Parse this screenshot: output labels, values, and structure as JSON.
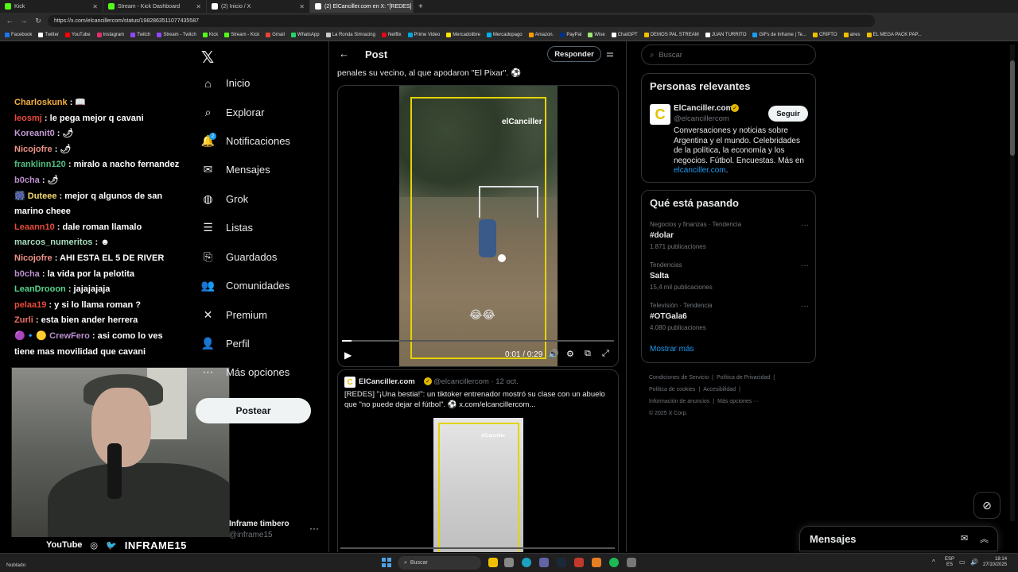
{
  "browser": {
    "tabs": [
      {
        "label": "Kick",
        "color": "#53fc18"
      },
      {
        "label": "Stream - Kick Dashboard",
        "color": "#53fc18"
      },
      {
        "label": "(2) Inicio / X",
        "color": "#ffffff"
      },
      {
        "label": "(2) ElCanciller.com en X: \"[REDES]",
        "color": "#ffffff"
      }
    ],
    "url": "https://x.com/elcancillercom/status/1982863511077435587",
    "bookmarks": [
      {
        "label": "Facebook",
        "color": "#1877f2"
      },
      {
        "label": "Twitter",
        "color": "#ffffff"
      },
      {
        "label": "YouTube",
        "color": "#ff0000"
      },
      {
        "label": "Instagram",
        "color": "#e1306c"
      },
      {
        "label": "Twitch",
        "color": "#9146ff"
      },
      {
        "label": "Stream - Twitch",
        "color": "#9146ff"
      },
      {
        "label": "Kick",
        "color": "#53fc18"
      },
      {
        "label": "Stream - Kick",
        "color": "#53fc18"
      },
      {
        "label": "Gmail",
        "color": "#ea4335"
      },
      {
        "label": "WhatsApp",
        "color": "#25d366"
      },
      {
        "label": "La Ronda Simracing",
        "color": "#cccccc"
      },
      {
        "label": "Netflix",
        "color": "#e50914"
      },
      {
        "label": "Prime Video",
        "color": "#00a8e1"
      },
      {
        "label": "Mercadolibre",
        "color": "#ffe600"
      },
      {
        "label": "Mercadopago",
        "color": "#00b1ea"
      },
      {
        "label": "Amazon.",
        "color": "#ff9900"
      },
      {
        "label": "PayPal",
        "color": "#003087"
      },
      {
        "label": "Wise",
        "color": "#9fe870"
      },
      {
        "label": "ChatGPT",
        "color": "#ffffff"
      },
      {
        "label": "DEMOS PAL STREAM",
        "color": "#f0c000"
      },
      {
        "label": "JUAN TURRITO",
        "color": "#ffffff"
      },
      {
        "label": "GIFs de Inframe | Te...",
        "color": "#1d9bf0"
      },
      {
        "label": "CRIPTO",
        "color": "#f0c000"
      },
      {
        "label": "aires",
        "color": "#f0c000"
      },
      {
        "label": "EL MEGA PACK PAP...",
        "color": "#f0c000"
      }
    ]
  },
  "chat": [
    {
      "user": "Charloskunk",
      "color": "#f5b041",
      "text": " : 📖"
    },
    {
      "user": "leosmj",
      "color": "#e74c3c",
      "text": " : le pega mejor q cavani"
    },
    {
      "user": "Koreanit0",
      "color": "#c39bd3",
      "text": " : 🌶"
    },
    {
      "user": "Nicojofre",
      "color": "#f1948a",
      "text": " : 🌶"
    },
    {
      "user": "franklinn120",
      "color": "#52be80",
      "text": " : miralo a nacho fernandez"
    },
    {
      "user": "b0cha",
      "color": "#bb8fce",
      "text": " : 🌶"
    },
    {
      "user": "🎆 Duteee",
      "color": "#f7dc6f",
      "text": " : mejor q algunos de san marino cheee"
    },
    {
      "user": "Leaann10",
      "color": "#e74c3c",
      "text": " : dale roman llamalo"
    },
    {
      "user": "marcos_numeritos",
      "color": "#a9dfbf",
      "text": " : ☻"
    },
    {
      "user": "Nicojofre",
      "color": "#f1948a",
      "text": " : AHI ESTA EL 5 DE RIVER"
    },
    {
      "user": "b0cha",
      "color": "#bb8fce",
      "text": " : la vida por la pelotita"
    },
    {
      "user": "LeanDrooon",
      "color": "#58d68d",
      "text": " : jajajajaja"
    },
    {
      "user": "pelaa19",
      "color": "#e74c3c",
      "text": " : y si lo llama roman ?"
    },
    {
      "user": "Zurli",
      "color": "#ec7063",
      "text": " : esta bien ander herrera"
    },
    {
      "user": "🟣🔹🟡 CrewFero",
      "color": "#bb8fce",
      "text": " : asi como lo ves tiene mas movilidad que cavani"
    }
  ],
  "stream_overlay": {
    "youtube": "YouTube",
    "brand": "INFRAME15"
  },
  "nav": {
    "items": [
      {
        "label": "Inicio",
        "icon": "home-icon",
        "glyph": "⌂"
      },
      {
        "label": "Explorar",
        "icon": "search-icon",
        "glyph": "⌕"
      },
      {
        "label": "Notificaciones",
        "icon": "bell-icon",
        "glyph": "🔔"
      },
      {
        "label": "Mensajes",
        "icon": "mail-icon",
        "glyph": "✉"
      },
      {
        "label": "Grok",
        "icon": "grok-icon",
        "glyph": "◍"
      },
      {
        "label": "Listas",
        "icon": "list-icon",
        "glyph": "☰"
      },
      {
        "label": "Guardados",
        "icon": "bookmark-icon",
        "glyph": "⎘"
      },
      {
        "label": "Comunidades",
        "icon": "community-icon",
        "glyph": "👥"
      },
      {
        "label": "Premium",
        "icon": "x-icon",
        "glyph": "✕"
      },
      {
        "label": "Perfil",
        "icon": "person-icon",
        "glyph": "👤"
      },
      {
        "label": "Más opciones",
        "icon": "more-icon",
        "glyph": "⋯"
      }
    ],
    "notification_badge": "2",
    "post_button": "Postear",
    "profile_name": "Inframe timbero",
    "profile_handle": "@inframe15"
  },
  "post": {
    "header_title": "Post",
    "reply_button": "Responder",
    "text": "penales su vecino, al que apodaron \"El Pixar\". ⚽",
    "video_watermark": "elCanciller",
    "video_emoji": "😂😂",
    "video_time": "0:01 / 0:29",
    "video_progress": 0.034
  },
  "quote": {
    "avatar_letter": "C",
    "name": "ElCanciller.com",
    "handle": "@elcancillercom · 12 oct.",
    "text": "[REDES] \"¡Una bestia!\": un tiktoker entrenador mostró su clase con un abuelo que \"no puede dejar el fútbol\". ⚽ x.com/elcancillercom...",
    "image_watermark": "elCanciller"
  },
  "sidebar": {
    "search_placeholder": "Buscar",
    "people_title": "Personas relevantes",
    "person": {
      "avatar_letter": "C",
      "name": "ElCanciller.com",
      "handle": "@elcancillercom",
      "follow": "Seguir",
      "bio": "Conversaciones y noticias sobre Argentina y el mundo. Celebridades de la política, la economía y los negocios. Fútbol. Encuestas. Más en ",
      "bio_link": "elcanciller.com",
      "bio_end": "."
    },
    "trends_title": "Qué está pasando",
    "trends": [
      {
        "category": "Negocios y finanzas · Tendencia",
        "name": "#dolar",
        "count": "1.871 publicaciones"
      },
      {
        "category": "Tendencias",
        "name": "Salta",
        "count": "15,4 mil publicaciones"
      },
      {
        "category": "Televisión · Tendencia",
        "name": "#OTGala6",
        "count": "4.080 publicaciones"
      }
    ],
    "show_more": "Mostrar más",
    "footer": [
      "Condiciones de Servicio",
      "|",
      "Política de Privacidad",
      "|",
      "Política de cookies",
      "|",
      "Accesibilidad",
      "|",
      "Información de anuncios",
      "|",
      "Más opciones ···",
      "© 2025 X Corp."
    ],
    "messages_dock": "Mensajes"
  },
  "taskbar": {
    "weather": "Nublado",
    "search": "Buscar",
    "lang_top": "ESP",
    "lang_bottom": "ES",
    "time": "18:14",
    "date": "27/10/2025"
  }
}
